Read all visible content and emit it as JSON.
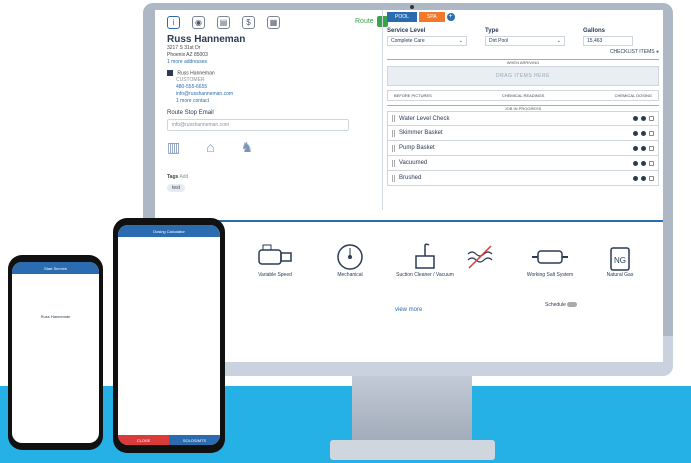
{
  "toolbar": {
    "route_label": "Route"
  },
  "customer": {
    "name": "Russ Hanneman",
    "address1": "3217 S 31st Dr",
    "address2": "Phoenix AZ 85003",
    "more_addresses": "1 more addresses",
    "contact_name": "Russ Hanneman",
    "contact_role": "CUSTOMER",
    "phone": "480-555-6655",
    "email": "info@russhanneman.com",
    "more_contacts": "1 more contact",
    "route_stop_email_label": "Route Stop Email",
    "route_stop_email_value": "info@russhanneman.com",
    "tags_label": "Tags",
    "tags_add": "Add",
    "tag": "test"
  },
  "tabs": {
    "pool": "POOL",
    "spa": "SPA"
  },
  "fields": {
    "service_level_label": "Service Level",
    "service_level_value": "Complete Care",
    "type_label": "Type",
    "type_value": "Dirt Pool",
    "gallons_label": "Gallons",
    "gallons_value": "15,463",
    "checklist_items_label": "CHECKLIST ITEMS"
  },
  "sections": {
    "when_arriving": "WHEN ARRIVING",
    "drag_items_here": "DRAG ITEMS HERE",
    "before_pictures": "BEFORE PICTURES",
    "chemical_readings": "CHEMICAL READINGS",
    "chemical_dosing": "CHEMICAL DOSING",
    "job_in_progress": "JOB IN PROGRESS"
  },
  "checklist": [
    "Water Level Check",
    "Skimmer Basket",
    "Pump Basket",
    "Vacuumed",
    "Brushed"
  ],
  "equipment": [
    {
      "label": "Variable Speed",
      "icon": "pump-icon"
    },
    {
      "label": "Mechanical",
      "icon": "timer-icon"
    },
    {
      "label": "Suction Cleaner / Vacuum",
      "icon": "cleaner-icon"
    },
    {
      "label": "",
      "icon": "heater-crossed-icon"
    },
    {
      "label": "Working Salt System",
      "icon": "salt-cell-icon"
    },
    {
      "label": "Natural Gas",
      "icon": "natural-gas-icon"
    }
  ],
  "view_more": "view more",
  "schedule": "Schedule",
  "phone_large": {
    "header": "Dosing Calculator",
    "left_btn": "CLOSE",
    "right_btn": "SOLOS/MTS"
  },
  "phone_small": {
    "header": "Start Service",
    "name": "Russ Hanneman"
  },
  "colors": {
    "brand_blue": "#2b6cb0",
    "band": "#25b1e6",
    "accent_orange": "#f07a2a",
    "route_green": "#3aa44a"
  }
}
